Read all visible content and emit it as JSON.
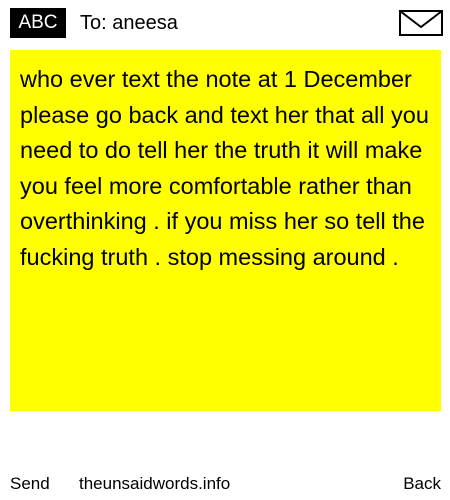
{
  "header": {
    "badge_label": "ABC",
    "to_prefix": "To:",
    "recipient": "aneesa",
    "envelope_icon": "envelope-icon"
  },
  "message": {
    "text": "who ever text the note at 1 December please go back and text her that all you need to do tell her the truth it will make you feel more comfortable rather than overthinking . if you miss her so tell the fucking truth . stop messing around .",
    "background_color": "#ffff00"
  },
  "footer": {
    "send_label": "Send",
    "site_label": "theunsaidwords.info",
    "back_label": "Back"
  }
}
